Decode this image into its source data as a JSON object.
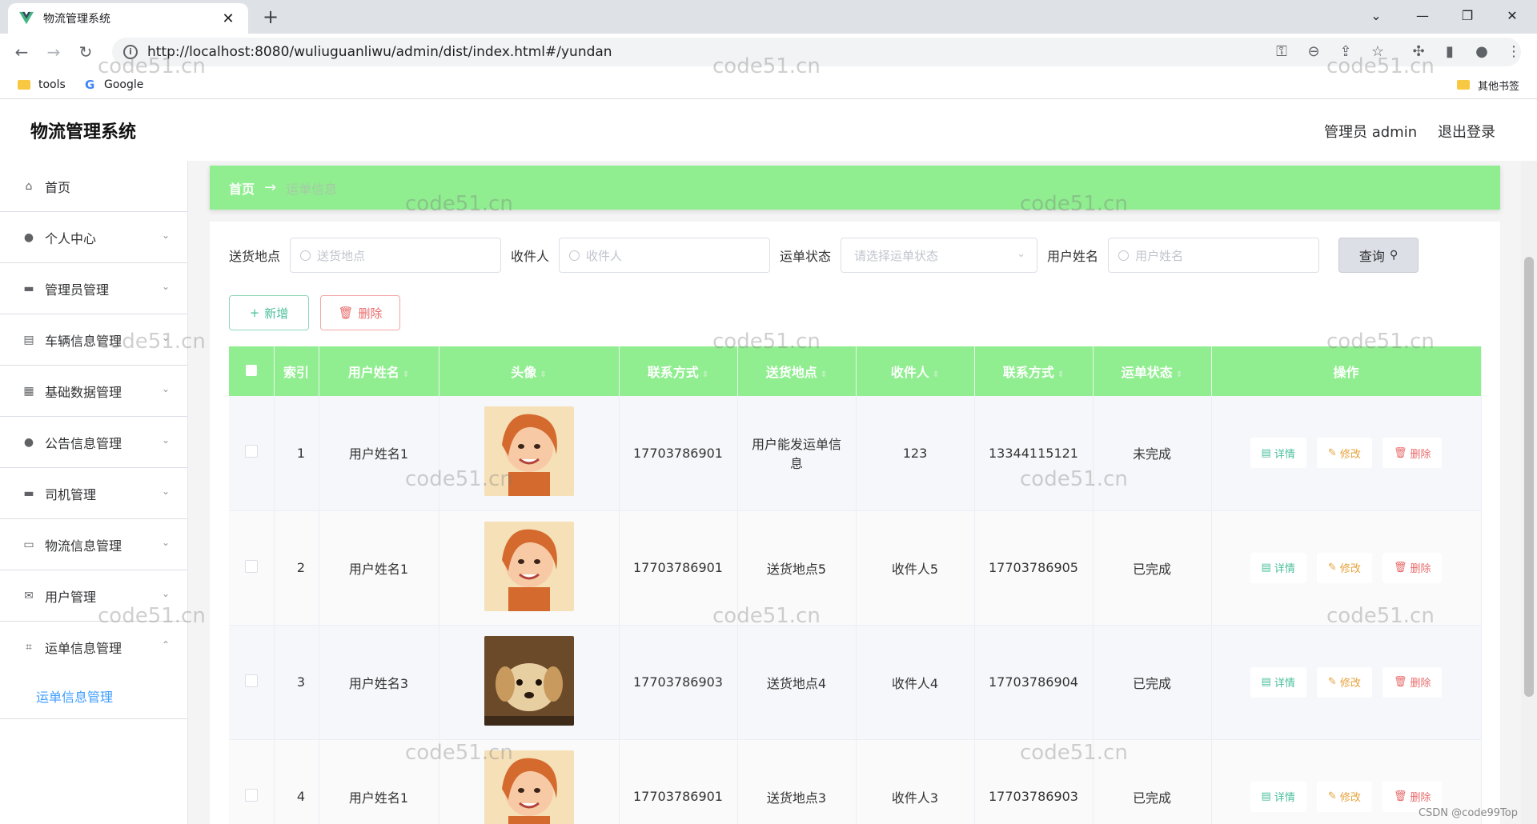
{
  "browser": {
    "tab_title": "物流管理系统",
    "url": "http://localhost:8080/wuliuguanliwu/admin/dist/index.html#/yundan",
    "bookmarks": [
      "tools",
      "Google"
    ],
    "other_bookmarks": "其他书签"
  },
  "app": {
    "title": "物流管理系统",
    "admin_label": "管理员 admin",
    "logout_label": "退出登录"
  },
  "sidebar": {
    "items": [
      {
        "label": "首页",
        "icon": "home-icon"
      },
      {
        "label": "个人中心",
        "icon": "user-icon"
      },
      {
        "label": "管理员管理",
        "icon": "chat-icon"
      },
      {
        "label": "车辆信息管理",
        "icon": "clipboard-icon"
      },
      {
        "label": "基础数据管理",
        "icon": "grid-icon"
      },
      {
        "label": "公告信息管理",
        "icon": "bulb-icon"
      },
      {
        "label": "司机管理",
        "icon": "message-icon"
      },
      {
        "label": "物流信息管理",
        "icon": "chat-dots-icon"
      },
      {
        "label": "用户管理",
        "icon": "mail-icon"
      },
      {
        "label": "运单信息管理",
        "icon": "crop-icon"
      }
    ],
    "submenu_item": "运单信息管理"
  },
  "breadcrumb": {
    "home": "首页",
    "arrow": "→",
    "current": "运单信息"
  },
  "search": {
    "fields": [
      {
        "label": "送货地点",
        "placeholder": "送货地点"
      },
      {
        "label": "收件人",
        "placeholder": "收件人"
      },
      {
        "label": "运单状态",
        "placeholder": "请选择运单状态"
      },
      {
        "label": "用户姓名",
        "placeholder": "用户姓名"
      }
    ],
    "query_label": "查询"
  },
  "actions": {
    "add_label": "新增",
    "delete_label": "删除"
  },
  "table": {
    "headers": [
      "索引",
      "用户姓名",
      "头像",
      "联系方式",
      "送货地点",
      "收件人",
      "联系方式",
      "运单状态",
      "操作"
    ],
    "rows": [
      {
        "index": "1",
        "name": "用户姓名1",
        "avatar": "girl-photo",
        "phone": "17703786901",
        "address": "用户能发运单信息",
        "recipient": "123",
        "recipient_phone": "13344115121",
        "status": "未完成"
      },
      {
        "index": "2",
        "name": "用户姓名1",
        "avatar": "girl-photo",
        "phone": "17703786901",
        "address": "送货地点5",
        "recipient": "收件人5",
        "recipient_phone": "17703786905",
        "status": "已完成"
      },
      {
        "index": "3",
        "name": "用户姓名3",
        "avatar": "puppy-photo",
        "phone": "17703786903",
        "address": "送货地点4",
        "recipient": "收件人4",
        "recipient_phone": "17703786904",
        "status": "已完成"
      },
      {
        "index": "4",
        "name": "用户姓名1",
        "avatar": "girl-photo",
        "phone": "17703786901",
        "address": "送货地点3",
        "recipient": "收件人3",
        "recipient_phone": "17703786903",
        "status": "已完成"
      }
    ],
    "row_actions": {
      "detail": "详情",
      "edit": "修改",
      "delete": "删除"
    }
  },
  "watermark": "code51.cn",
  "credit": "CSDN @code99Top"
}
